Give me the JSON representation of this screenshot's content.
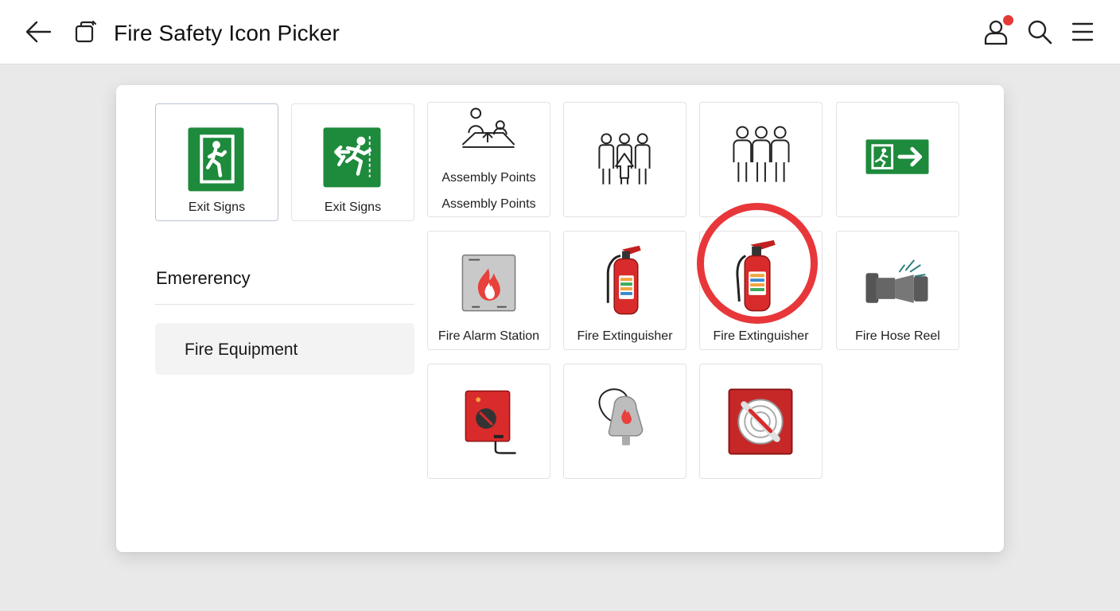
{
  "header": {
    "title": "Fire Safety Icon Picker",
    "icons": [
      "back-arrow-icon",
      "window-icon",
      "user-icon",
      "search-icon",
      "menu-icon"
    ],
    "notification_dot_color": "#e53935"
  },
  "sidebar": {
    "section_title": "Emererency",
    "category": "Fire Equipment"
  },
  "tiles": [
    {
      "label": "Exit Signs",
      "icon": "exit-door-sign-icon",
      "selected": true
    },
    {
      "label": "Exit Signs",
      "icon": "running-exit-sign-icon"
    },
    {
      "label": "Assembly Points",
      "icon": "assembly-group-icon",
      "caption_in_art": "Assembly Points"
    },
    {
      "label": "",
      "icon": "assembly-point-arrow-icon"
    },
    {
      "label": "",
      "icon": "three-people-icon"
    },
    {
      "label": "",
      "icon": "exit-arrow-sign-icon"
    },
    {
      "label": "Fire Alarm Station",
      "icon": "fire-alarm-station-icon"
    },
    {
      "label": "Fire Extinguisher",
      "icon": "fire-extinguisher-icon"
    },
    {
      "label": "Fire Extinguisher",
      "icon": "fire-extinguisher-icon",
      "highlighted": true
    },
    {
      "label": "Fire Hose Reel",
      "icon": "fire-hose-reel-icon"
    },
    {
      "label": "",
      "icon": "fire-alarm-button-icon"
    },
    {
      "label": "",
      "icon": "fire-blanket-icon"
    },
    {
      "label": "",
      "icon": "hose-reel-box-icon"
    }
  ],
  "colors": {
    "exit_green": "#1e8a3c",
    "fire_red": "#d92b2b",
    "highlight_ring": "#e8373a"
  }
}
